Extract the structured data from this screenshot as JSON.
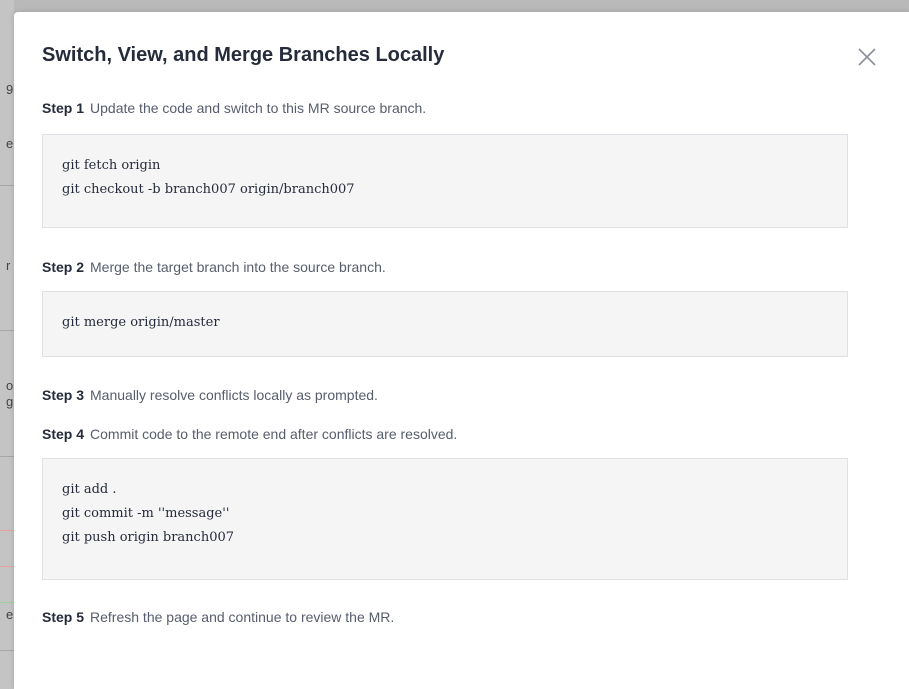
{
  "background": {
    "chars": [
      "9",
      "e",
      "r",
      "o",
      "g",
      "e"
    ]
  },
  "dialog": {
    "title": "Switch, View, and Merge Branches Locally",
    "close_icon": "close-icon",
    "steps": [
      {
        "label": "Step 1",
        "text": "Update the code and switch to this MR source branch."
      },
      {
        "label": "Step 2",
        "text": "Merge the target branch into the source branch."
      },
      {
        "label": "Step 3",
        "text": "Manually resolve conflicts locally as prompted."
      },
      {
        "label": "Step 4",
        "text": "Commit code to the remote end after conflicts are resolved."
      },
      {
        "label": "Step 5",
        "text": "Refresh the page and continue to review the MR."
      }
    ],
    "code_blocks": [
      {
        "lines": [
          "git fetch origin",
          "git checkout -b branch007 origin/branch007"
        ]
      },
      {
        "lines": [
          "git merge origin/master"
        ]
      },
      {
        "lines": [
          "git add .",
          "git commit -m ''message''",
          "git push origin branch007"
        ]
      }
    ]
  },
  "colors": {
    "title": "#252b3a",
    "text": "#575d6c",
    "code_bg": "#f5f5f6",
    "code_border": "#dfe1e6"
  }
}
